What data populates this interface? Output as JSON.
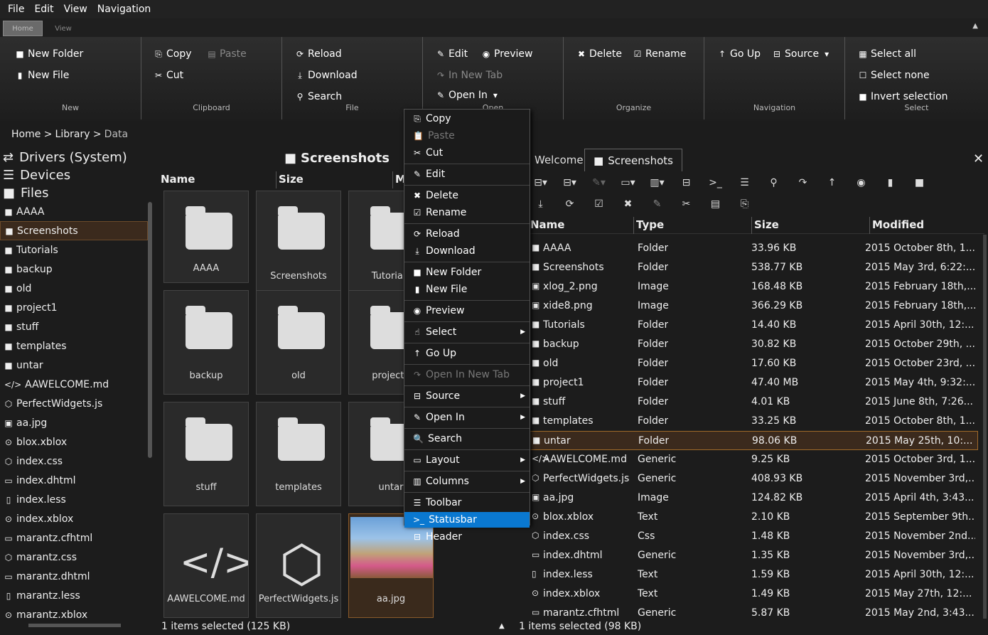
{
  "menubar": {
    "file": "File",
    "edit": "Edit",
    "view": "View",
    "navigation": "Navigation"
  },
  "ribbon_tabs": {
    "home": "Home",
    "view": "View",
    "collapse": "▲"
  },
  "ribbon": {
    "new": {
      "title": "New",
      "new_folder": "New Folder",
      "new_file": "New File"
    },
    "clipboard": {
      "title": "Clipboard",
      "copy": "Copy",
      "paste": "Paste",
      "cut": "Cut"
    },
    "file": {
      "title": "File",
      "reload": "Reload",
      "download": "Download",
      "search": "Search"
    },
    "open": {
      "title": "Open",
      "edit": "Edit",
      "preview": "Preview",
      "in_new_tab": "In New Tab",
      "open_in": "Open In"
    },
    "organize": {
      "title": "Organize",
      "delete": "Delete",
      "rename": "Rename"
    },
    "navigation": {
      "title": "Navigation",
      "go_up": "Go Up",
      "source": "Source"
    },
    "select": {
      "title": "Select",
      "select_all": "Select all",
      "select_none": "Select none",
      "invert": "Invert selection"
    }
  },
  "breadcrumb": {
    "home": "Home >",
    "library": "Library >",
    "current": "Data"
  },
  "tree": {
    "roots": [
      "Drivers (System)",
      "Devices",
      "Files"
    ],
    "items": [
      {
        "icon": "folder",
        "label": "AAAA"
      },
      {
        "icon": "folder",
        "label": "Screenshots"
      },
      {
        "icon": "folder",
        "label": "Tutorials"
      },
      {
        "icon": "folder",
        "label": "backup"
      },
      {
        "icon": "folder",
        "label": "old"
      },
      {
        "icon": "folder",
        "label": "project1"
      },
      {
        "icon": "folder",
        "label": "stuff"
      },
      {
        "icon": "folder",
        "label": "templates"
      },
      {
        "icon": "folder",
        "label": "untar"
      },
      {
        "icon": "code",
        "label": "AAWELCOME.md"
      },
      {
        "icon": "cube",
        "label": "PerfectWidgets.js"
      },
      {
        "icon": "image",
        "label": "aa.jpg"
      },
      {
        "icon": "circle",
        "label": "blox.xblox"
      },
      {
        "icon": "cube",
        "label": "index.css"
      },
      {
        "icon": "laptop",
        "label": "index.dhtml"
      },
      {
        "icon": "file",
        "label": "index.less"
      },
      {
        "icon": "circle",
        "label": "index.xblox"
      },
      {
        "icon": "laptop",
        "label": "marantz.cfhtml"
      },
      {
        "icon": "cube",
        "label": "marantz.css"
      },
      {
        "icon": "laptop",
        "label": "marantz.dhtml"
      },
      {
        "icon": "file",
        "label": "marantz.less"
      },
      {
        "icon": "circle",
        "label": "marantz.xblox"
      }
    ]
  },
  "middle": {
    "title": "Screenshots",
    "columns": {
      "name": "Name",
      "size": "Size",
      "modified": "M"
    },
    "tiles": [
      "AAAA",
      "Screenshots",
      "Tutorials",
      "backup",
      "old",
      "project1",
      "stuff",
      "templates",
      "untar",
      "AAWELCOME.md",
      "PerfectWidgets.js",
      "aa.jpg"
    ],
    "status": "1 items selected (125 KB)",
    "status_arrow": "▲"
  },
  "tabs": {
    "welcome": "Welcome",
    "screenshots": "Screenshots",
    "close": "✕"
  },
  "list": {
    "columns": {
      "name": "Name",
      "type": "Type",
      "size": "Size",
      "modified": "Modified"
    },
    "rows": [
      {
        "icon": "folder",
        "name": "AAAA",
        "type": "Folder",
        "size": "33.96 KB",
        "modified": "2015 October 8th, 1..."
      },
      {
        "icon": "folder",
        "name": "Screenshots",
        "type": "Folder",
        "size": "538.77 KB",
        "modified": "2015 May 3rd, 6:22:..."
      },
      {
        "icon": "image",
        "name": "xlog_2.png",
        "type": "Image",
        "size": "168.48 KB",
        "modified": "2015 February 18th,..."
      },
      {
        "icon": "image",
        "name": "xide8.png",
        "type": "Image",
        "size": "366.29 KB",
        "modified": "2015 February 18th,..."
      },
      {
        "icon": "folder",
        "name": "Tutorials",
        "type": "Folder",
        "size": "14.40 KB",
        "modified": "2015 April 30th, 12:..."
      },
      {
        "icon": "folder",
        "name": "backup",
        "type": "Folder",
        "size": "30.82 KB",
        "modified": "2015 October 29th, ..."
      },
      {
        "icon": "folder",
        "name": "old",
        "type": "Folder",
        "size": "17.60 KB",
        "modified": "2015 October 23rd, ..."
      },
      {
        "icon": "folder",
        "name": "project1",
        "type": "Folder",
        "size": "47.40 MB",
        "modified": "2015 May 4th, 9:32:..."
      },
      {
        "icon": "folder",
        "name": "stuff",
        "type": "Folder",
        "size": "4.01 KB",
        "modified": "2015 June 8th, 7:26..."
      },
      {
        "icon": "folder",
        "name": "templates",
        "type": "Folder",
        "size": "33.25 KB",
        "modified": "2015 October 8th, 1..."
      },
      {
        "icon": "folder",
        "name": "untar",
        "type": "Folder",
        "size": "98.06 KB",
        "modified": "2015 May 25th, 10:..."
      },
      {
        "icon": "code",
        "name": "AAWELCOME.md",
        "type": "Generic",
        "size": "9.25 KB",
        "modified": "2015 October 3rd, 1..."
      },
      {
        "icon": "cube",
        "name": "PerfectWidgets.js",
        "type": "Generic",
        "size": "408.93 KB",
        "modified": "2015 November 3rd,..."
      },
      {
        "icon": "image",
        "name": "aa.jpg",
        "type": "Image",
        "size": "124.82 KB",
        "modified": "2015 April 4th, 3:43..."
      },
      {
        "icon": "circle",
        "name": "blox.xblox",
        "type": "Text",
        "size": "2.10 KB",
        "modified": "2015 September 9th..."
      },
      {
        "icon": "cube",
        "name": "index.css",
        "type": "Css",
        "size": "1.48 KB",
        "modified": "2015 November 2nd..."
      },
      {
        "icon": "laptop",
        "name": "index.dhtml",
        "type": "Generic",
        "size": "1.35 KB",
        "modified": "2015 November 3rd,..."
      },
      {
        "icon": "file",
        "name": "index.less",
        "type": "Text",
        "size": "1.59 KB",
        "modified": "2015 April 30th, 12:..."
      },
      {
        "icon": "circle",
        "name": "index.xblox",
        "type": "Text",
        "size": "1.49 KB",
        "modified": "2015 May 27th, 12:..."
      },
      {
        "icon": "laptop",
        "name": "marantz.cfhtml",
        "type": "Generic",
        "size": "5.87 KB",
        "modified": "2015 May 2nd, 3:43..."
      }
    ],
    "status": "1 items selected (98 KB)"
  },
  "context_menu": {
    "items": [
      {
        "label": "Copy",
        "icon": "copy-icon",
        "glyph": "⎘"
      },
      {
        "label": "Paste",
        "icon": "paste-icon",
        "glyph": "📋",
        "disabled": true
      },
      {
        "label": "Cut",
        "icon": "cut-icon",
        "glyph": "✂"
      },
      {
        "label": "Edit",
        "icon": "pencil-icon",
        "glyph": "✎",
        "divider_before": true
      },
      {
        "label": "Delete",
        "icon": "delete-icon",
        "glyph": "✖",
        "divider_before": true
      },
      {
        "label": "Rename",
        "icon": "rename-icon",
        "glyph": "☑"
      },
      {
        "label": "Reload",
        "icon": "reload-icon",
        "glyph": "⟳",
        "divider_before": true
      },
      {
        "label": "Download",
        "icon": "download-icon",
        "glyph": "⤓"
      },
      {
        "label": "New Folder",
        "icon": "folder-icon",
        "glyph": "■",
        "divider_before": true
      },
      {
        "label": "New File",
        "icon": "file-icon",
        "glyph": "▮"
      },
      {
        "label": "Preview",
        "icon": "eye-icon",
        "glyph": "◉",
        "divider_before": true
      },
      {
        "label": "Select",
        "icon": "hand-icon",
        "glyph": "☝",
        "submenu": true,
        "divider_before": true
      },
      {
        "label": "Go Up",
        "icon": "up-icon",
        "glyph": "↑",
        "divider_before": true
      },
      {
        "label": "Open In New Tab",
        "icon": "share-icon",
        "glyph": "↷",
        "disabled": true,
        "divider_before": true
      },
      {
        "label": "Source",
        "icon": "drive-icon",
        "glyph": "⊟",
        "submenu": true,
        "divider_before": true
      },
      {
        "label": "Open In",
        "icon": "pencil-icon",
        "glyph": "✎",
        "submenu": true,
        "divider_before": true
      },
      {
        "label": "Search",
        "icon": "search-icon",
        "glyph": "🔍",
        "divider_before": true
      },
      {
        "label": "Layout",
        "icon": "laptop-icon",
        "glyph": "▭",
        "submenu": true,
        "divider_before": true
      },
      {
        "label": "Columns",
        "icon": "columns-icon",
        "glyph": "▥",
        "submenu": true,
        "divider_before": true
      },
      {
        "label": "Toolbar",
        "icon": "menu-icon",
        "glyph": "☰",
        "divider_before": true
      },
      {
        "label": "Statusbar",
        "icon": "terminal-icon",
        "glyph": ">_",
        "highlighted": true
      },
      {
        "label": "Header",
        "icon": "header-icon",
        "glyph": "⊟"
      }
    ],
    "submenu_arrow": "▶"
  },
  "colors": {
    "accent": "#0a78d0",
    "selection": "#3b2a1d",
    "selection_border": "#a06a2a"
  }
}
